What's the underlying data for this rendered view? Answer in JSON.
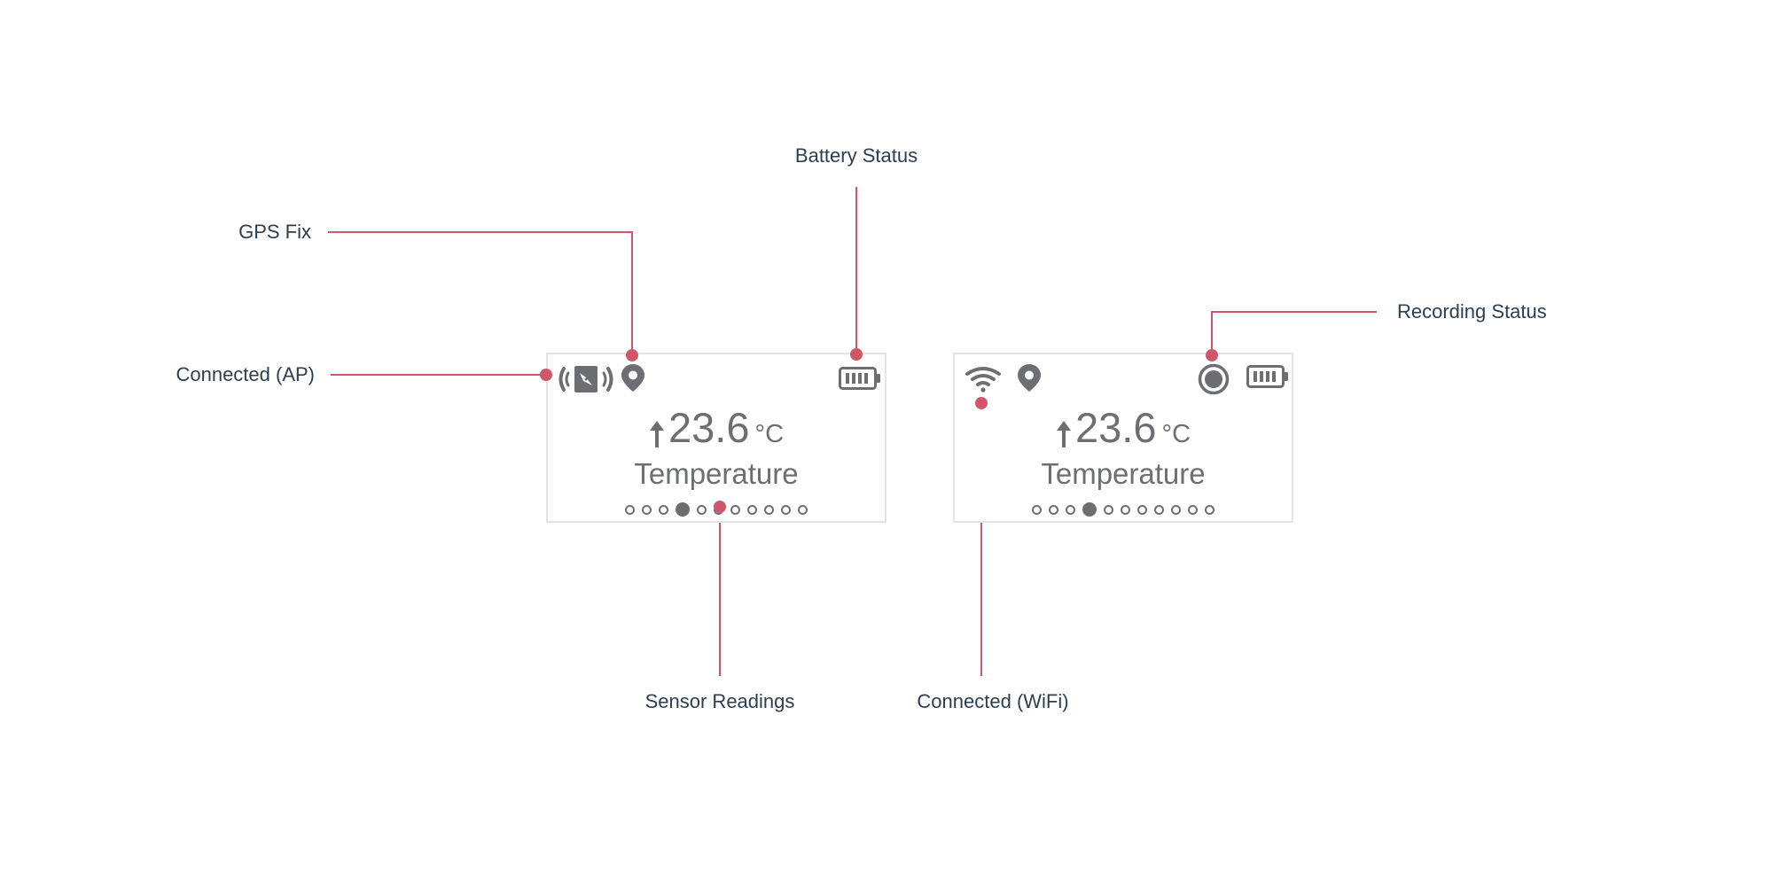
{
  "colors": {
    "accent": "#cf5769",
    "label_text": "#2c3e50",
    "icon_grey": "#6d6e72",
    "card_border": "#e4e4e6"
  },
  "annotations": {
    "gps_fix": "GPS Fix",
    "connected_ap": "Connected (AP)",
    "battery_status": "Battery Status",
    "recording_status": "Recording Status",
    "sensor_readings": "Sensor Readings",
    "connected_wifi": "Connected (WiFi)"
  },
  "screens": [
    {
      "status_icons_left": [
        "access-point-icon",
        "location-pin-icon"
      ],
      "status_icons_right": [
        "battery-full-icon"
      ],
      "trend": "up-arrow-icon",
      "value": "23.6",
      "unit": "°C",
      "sensor_name": "Temperature",
      "page_count": 11,
      "active_page": 4
    },
    {
      "status_icons_left": [
        "wifi-icon",
        "location-pin-icon"
      ],
      "status_icons_right": [
        "recording-icon",
        "battery-full-icon"
      ],
      "trend": "up-arrow-icon",
      "value": "23.6",
      "unit": "°C",
      "sensor_name": "Temperature",
      "page_count": 11,
      "active_page": 4
    }
  ]
}
